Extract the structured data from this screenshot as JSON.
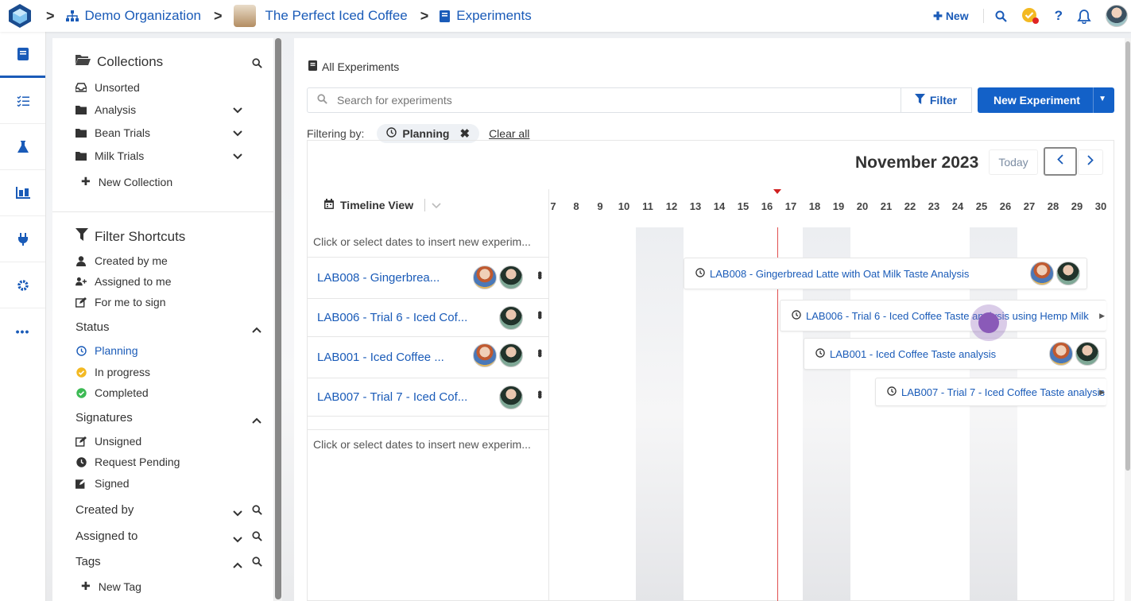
{
  "breadcrumb": {
    "org": "Demo Organization",
    "project": "The Perfect Iced Coffee",
    "section": "Experiments"
  },
  "topbar": {
    "new_label": "New"
  },
  "sidebar": {
    "collections_title": "Collections",
    "collections": [
      {
        "label": "Unsorted"
      },
      {
        "label": "Analysis"
      },
      {
        "label": "Bean Trials"
      },
      {
        "label": "Milk Trials"
      }
    ],
    "new_collection": "New Collection",
    "filter_title": "Filter Shortcuts",
    "shortcuts": [
      "Created by me",
      "Assigned to me",
      "For me to sign"
    ],
    "status_title": "Status",
    "status": [
      "Planning",
      "In progress",
      "Completed"
    ],
    "signatures_title": "Signatures",
    "signatures": [
      "Unsigned",
      "Request Pending",
      "Signed"
    ],
    "created_by": "Created by",
    "assigned_to": "Assigned to",
    "tags": "Tags",
    "new_tag": "New Tag"
  },
  "main": {
    "all_experiments": "All Experiments",
    "search_placeholder": "Search for experiments",
    "filter_label": "Filter",
    "new_experiment": "New Experiment",
    "filtering_by": "Filtering by:",
    "chip": "Planning",
    "clear_all": "Clear all",
    "month": "November 2023",
    "today": "Today",
    "timeline_view": "Timeline View",
    "insert_hint": "Click or select dates to insert new experim...",
    "days": [
      "7",
      "8",
      "9",
      "10",
      "11",
      "12",
      "13",
      "14",
      "15",
      "16",
      "17",
      "18",
      "19",
      "20",
      "21",
      "22",
      "23",
      "24",
      "25",
      "26",
      "27",
      "28",
      "29",
      "30"
    ],
    "rows": [
      {
        "name": "LAB008 - Gingerbrea..."
      },
      {
        "name": "LAB006 - Trial 6 - Iced Cof..."
      },
      {
        "name": "LAB001 - Iced Coffee ..."
      },
      {
        "name": "LAB007 - Trial 7 - Iced Cof..."
      }
    ],
    "events": [
      {
        "label": "LAB008 - Gingerbread Latte with Oat Milk Taste Analysis"
      },
      {
        "label": "LAB006 - Trial 6 - Iced Coffee Taste analysis using Hemp Milk"
      },
      {
        "label": "LAB001 - Iced Coffee Taste analysis"
      },
      {
        "label": "LAB007 - Trial 7 - Iced Coffee Taste analysis"
      }
    ]
  },
  "colors": {
    "primary": "#1361c8",
    "link": "#1a5bb8",
    "today_line": "#e05050",
    "in_progress": "#f3b922",
    "completed": "#3cba54"
  }
}
